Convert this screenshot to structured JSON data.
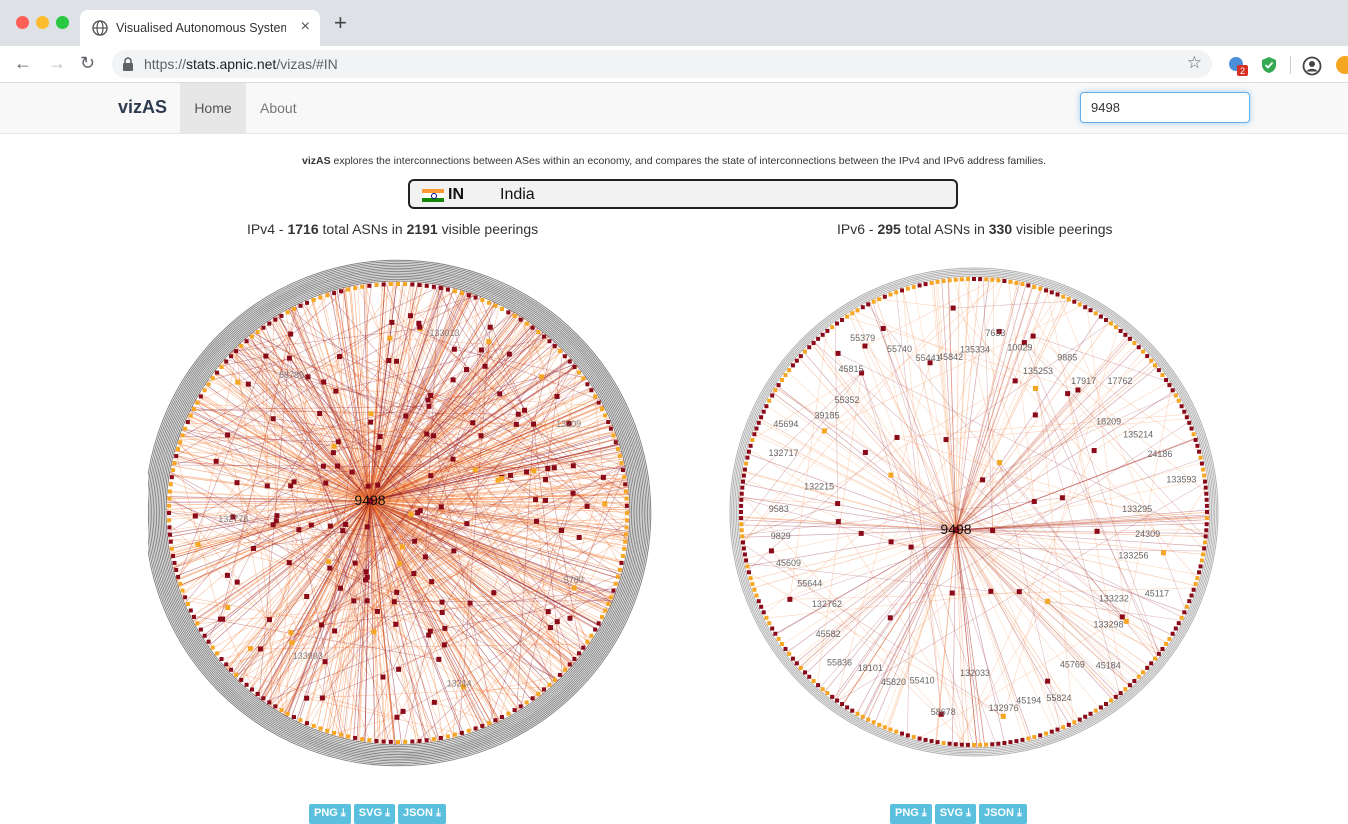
{
  "browser": {
    "tab_title": "Visualised Autonomous System",
    "url_scheme": "https://",
    "url_host": "stats.apnic.net",
    "url_path": "/vizas/#IN",
    "extension_badge": "2"
  },
  "nav": {
    "brand": "vizAS",
    "home": "Home",
    "about": "About",
    "search_value": "9498"
  },
  "intro": {
    "brand": "vizAS",
    "text": " explores the interconnections between ASes within an economy, and compares the state of interconnections between the IPv4 and IPv6 address families."
  },
  "country": {
    "code": "IN",
    "name": "India"
  },
  "ipv4": {
    "label": "IPv4 - ",
    "asns": "1716",
    "mid": " total ASNs in ",
    "peerings": "2191",
    "tail": " visible peerings",
    "center_asn": "9498",
    "labels": [
      "9498",
      "5780",
      "13214",
      "133993",
      "132778",
      "58780",
      "133013",
      "13209"
    ]
  },
  "ipv6": {
    "label": "IPv6 - ",
    "asns": "295",
    "mid": " total ASNs in ",
    "peerings": "330",
    "tail": " visible peerings",
    "center_asn": "9498",
    "labels": [
      {
        "t": "135334"
      },
      {
        "t": "7633"
      },
      {
        "t": "10029"
      },
      {
        "t": "135253"
      },
      {
        "t": "9885"
      },
      {
        "t": "17917"
      },
      {
        "t": "17762"
      },
      {
        "t": "18209"
      },
      {
        "t": "135214"
      },
      {
        "t": "24186"
      },
      {
        "t": "133593"
      },
      {
        "t": "133295"
      },
      {
        "t": "24309"
      },
      {
        "t": "133256"
      },
      {
        "t": "45117"
      },
      {
        "t": "133232"
      },
      {
        "t": "133298"
      },
      {
        "t": "45184"
      },
      {
        "t": "45769"
      },
      {
        "t": "55824"
      },
      {
        "t": "45194"
      },
      {
        "t": "132976"
      },
      {
        "t": "132033"
      },
      {
        "t": "58678"
      },
      {
        "t": "55410"
      },
      {
        "t": "45820"
      },
      {
        "t": "18101"
      },
      {
        "t": "55836"
      },
      {
        "t": "45582"
      },
      {
        "t": "132762"
      },
      {
        "t": "55644"
      },
      {
        "t": "45609"
      },
      {
        "t": "9829"
      },
      {
        "t": "9583"
      },
      {
        "t": "132215"
      },
      {
        "t": "132717"
      },
      {
        "t": "45694"
      },
      {
        "t": "39185"
      },
      {
        "t": "55352"
      },
      {
        "t": "45815"
      },
      {
        "t": "55379"
      },
      {
        "t": "55740"
      },
      {
        "t": "55441"
      },
      {
        "t": "45842"
      }
    ]
  },
  "downloads": {
    "png": "PNG",
    "svg": "SVG",
    "json": "JSON",
    "icon": "⤓"
  },
  "colors": {
    "edge_dark": "#8b0a1a",
    "edge_orange": "#f26b1d",
    "edge_light": "#f7a86b",
    "node": "#8b0a1a",
    "node_orange": "#f5a623",
    "ring": "#222222"
  }
}
